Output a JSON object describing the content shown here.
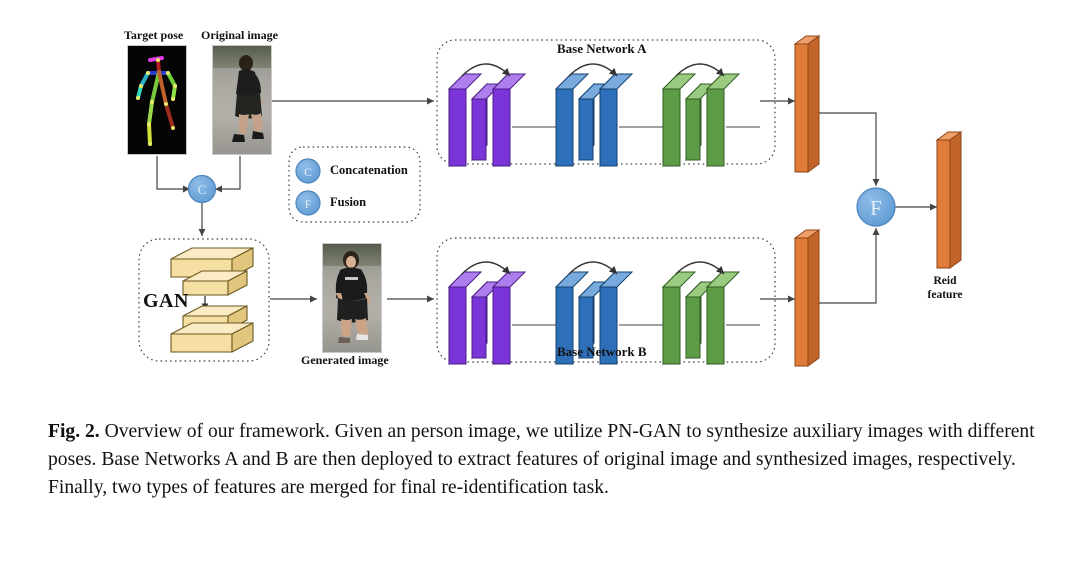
{
  "figure": {
    "labels": {
      "target_pose": "Target pose",
      "original_image": "Original image",
      "generated_image": "Generated image",
      "gan": "GAN",
      "base_network_a": "Base Network A",
      "base_network_b": "Base Network B",
      "reid_feature_line1": "Reid",
      "reid_feature_line2": "feature"
    },
    "nodes": {
      "concat_symbol": "C",
      "fusion_symbol": "F"
    },
    "legend": [
      {
        "symbol": "C",
        "label": "Concatenation"
      },
      {
        "symbol": "F",
        "label": "Fusion"
      }
    ],
    "colors": {
      "block_purple_front": "#7B34D8",
      "block_purple_top": "#9B63E6",
      "block_purple_side": "#8A4BE0",
      "block_blue_front": "#2E6FBA",
      "block_blue_top": "#5B93D1",
      "block_blue_side": "#3E7EC6",
      "block_green_front": "#5D9B46",
      "block_green_top": "#80B763",
      "block_green_side": "#6CA855",
      "bar_orange_front": "#E07B39",
      "bar_orange_top": "#EFA06A",
      "bar_orange_side": "#C2652B",
      "gan_slab_face": "#F6DFA2",
      "gan_slab_top": "#FAEBC4",
      "gan_slab_side": "#E2C67E",
      "node_circle": "#6FA8DC",
      "node_circle_stroke": "#4C85BE",
      "dashed_border": "#444444",
      "arrow": "#444444",
      "background": "#FFFFFF"
    }
  },
  "caption": {
    "figure_number": "Fig. 2.",
    "text": " Overview of our framework. Given an person image, we utilize PN-GAN to synthesize auxiliary images with different poses. Base Networks A and B are then deployed to extract features of original image and synthesized images, respectively. Finally, two types of features are merged for final re-identification task."
  }
}
